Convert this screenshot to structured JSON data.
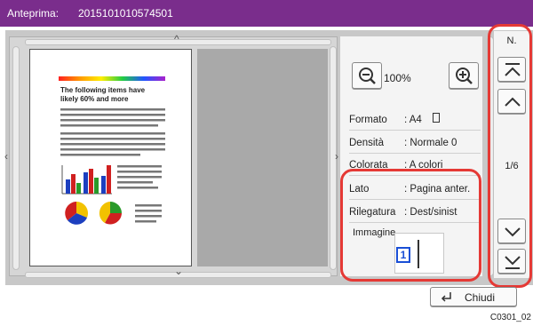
{
  "titlebar": {
    "label": "Anteprima:",
    "doc_id": "2015101010574501"
  },
  "preview": {
    "page_heading": "The following items have likely 60% and more",
    "colors": {
      "bar1": "#1c3fbf",
      "bar2": "#d02020",
      "bar3": "#2a9a2a",
      "pie_red": "#d02020",
      "pie_yellow": "#f2c200",
      "pie_blue": "#1c3fbf",
      "pie_green": "#2a9a2a"
    }
  },
  "zoom": {
    "level": "100%",
    "out_icon": "zoom-out-icon",
    "in_icon": "zoom-in-icon"
  },
  "info": {
    "formato": {
      "label": "Formato",
      "value": ": A4"
    },
    "densita": {
      "label": "Densità",
      "value": ": Normale 0"
    },
    "colorata": {
      "label": "Colorata",
      "value": ": A colori"
    },
    "lato": {
      "label": "Lato",
      "value": ": Pagina anter."
    },
    "rilegatura": {
      "label": "Rilegatura",
      "value": ": Dest/sinist"
    },
    "immagine": {
      "label": "Immagine",
      "value": "1"
    }
  },
  "pager": {
    "label": "N.",
    "count": "1/6"
  },
  "close": {
    "label": "Chiudi"
  },
  "footer": {
    "code": "C0301_02"
  },
  "accent": {
    "title": "#7a2d8c",
    "highlight": "#e53935"
  }
}
